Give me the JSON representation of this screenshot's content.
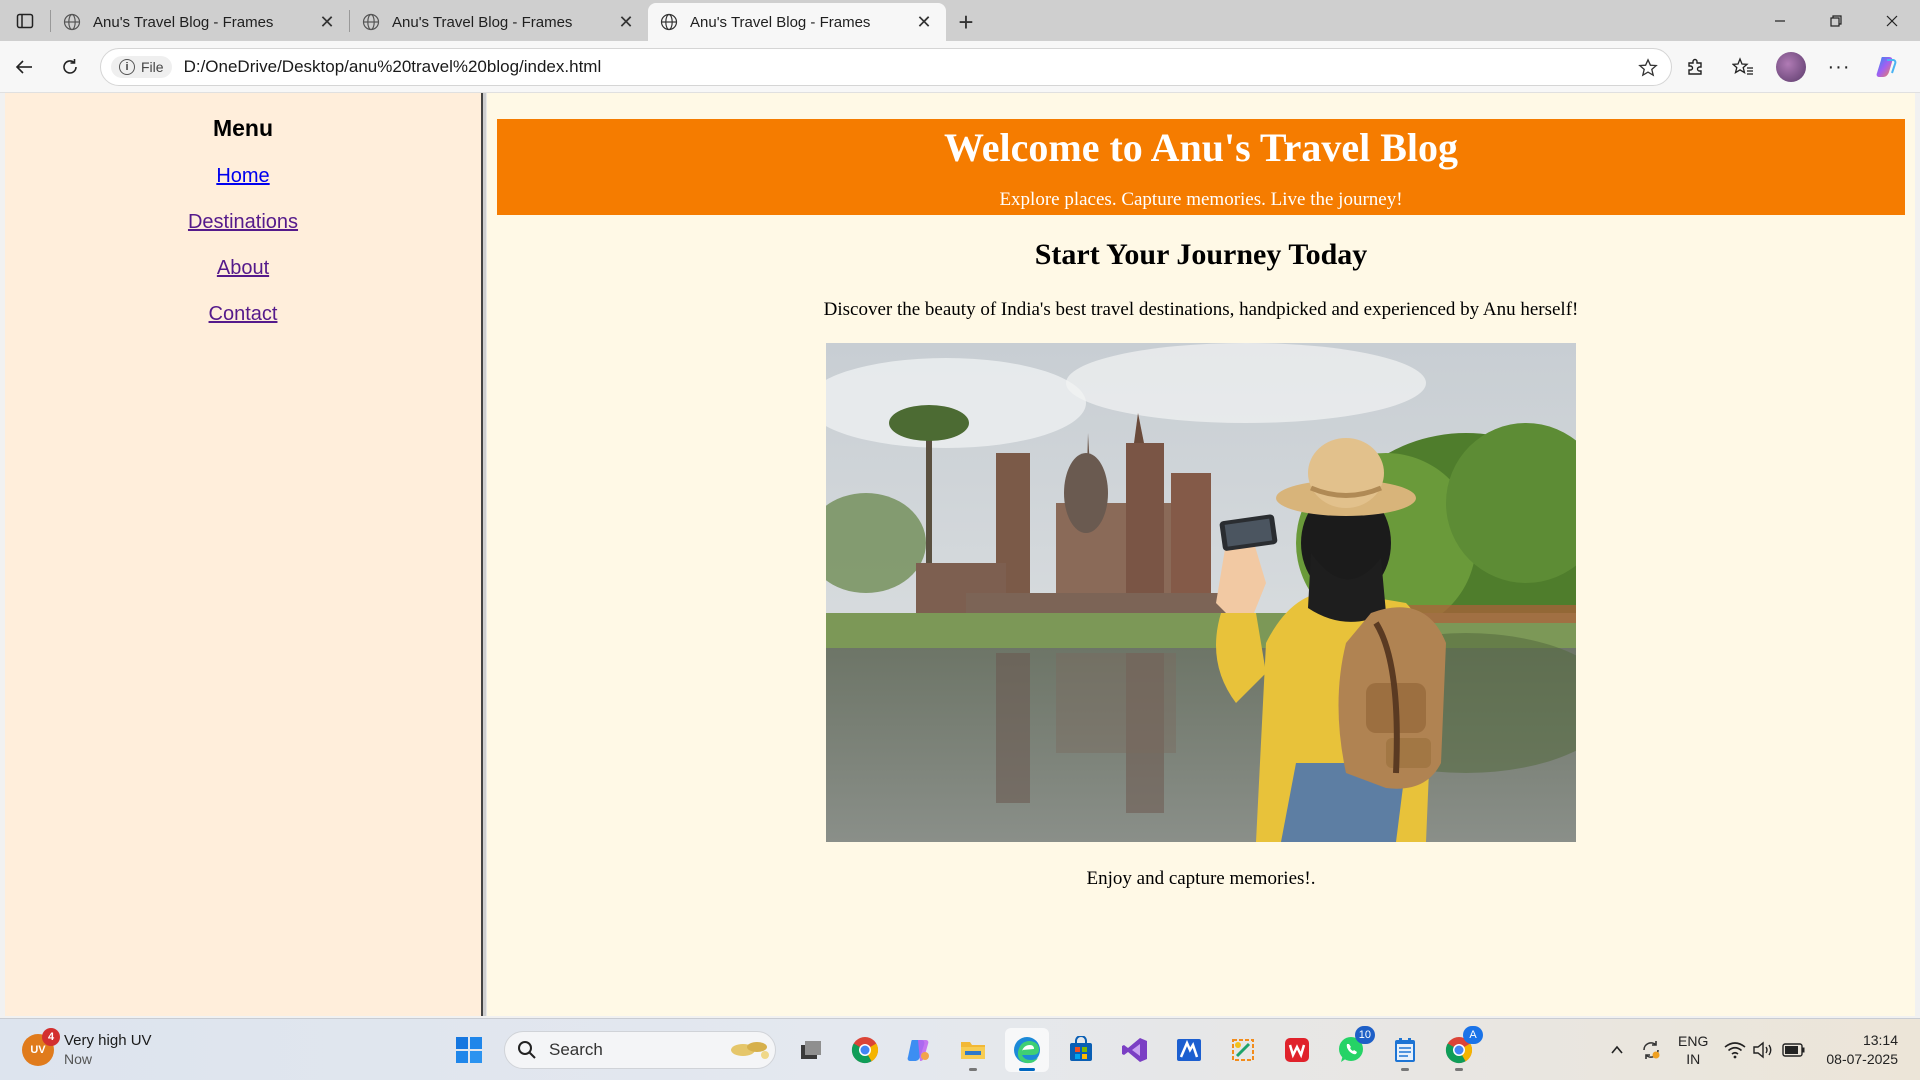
{
  "browser": {
    "tabs": [
      {
        "title": "Anu's Travel Blog - Frames",
        "active": false
      },
      {
        "title": "Anu's Travel Blog - Frames",
        "active": false
      },
      {
        "title": "Anu's Travel Blog - Frames",
        "active": true
      }
    ],
    "site_info_label": "File",
    "url": "D:/OneDrive/Desktop/anu%20travel%20blog/index.html"
  },
  "menu": {
    "title": "Menu",
    "links": [
      "Home",
      "Destinations",
      "About",
      "Contact"
    ]
  },
  "banner": {
    "title": "Welcome to Anu's Travel Blog",
    "subtitle": "Explore places. Capture memories. Live the journey!",
    "color": "#f57c00"
  },
  "content": {
    "heading": "Start Your Journey Today",
    "intro": "Discover the beauty of India's best travel destinations, handpicked and experienced by Anu herself!",
    "caption": "Enjoy and capture memories!."
  },
  "taskbar": {
    "weather_title": "Very high UV",
    "weather_sub": "Now",
    "uv_icon_label": "UV",
    "weather_badge": "4",
    "search_label": "Search",
    "whatsapp_badge": "10",
    "chrome_badge": "A",
    "lang_top": "ENG",
    "lang_bottom": "IN",
    "time": "13:14",
    "date": "08-07-2025"
  }
}
